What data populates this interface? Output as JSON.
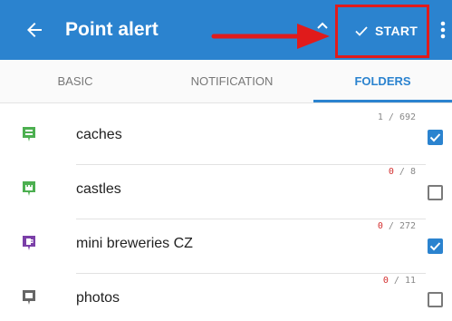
{
  "appbar": {
    "title": "Point alert",
    "start_label": "START",
    "color": "#2b83cf",
    "highlight_color": "#e01b1b"
  },
  "tabs": [
    {
      "label": "BASIC",
      "active": false
    },
    {
      "label": "NOTIFICATION",
      "active": false
    },
    {
      "label": "FOLDERS",
      "active": true
    }
  ],
  "folders": [
    {
      "name": "caches",
      "count_done": "1",
      "count_total": "692",
      "checked": true,
      "icon": "caches-folder-icon",
      "icon_color": "#4caf50"
    },
    {
      "name": "castles",
      "count_done": "0",
      "count_total": "8",
      "checked": false,
      "icon": "castle-folder-icon",
      "icon_color": "#4caf50"
    },
    {
      "name": "mini breweries CZ",
      "count_done": "0",
      "count_total": "272",
      "checked": true,
      "icon": "brewery-folder-icon",
      "icon_color": "#7b3fa8"
    },
    {
      "name": "photos",
      "count_done": "0",
      "count_total": "11",
      "checked": false,
      "icon": "photo-folder-icon",
      "icon_color": "#666666"
    }
  ]
}
